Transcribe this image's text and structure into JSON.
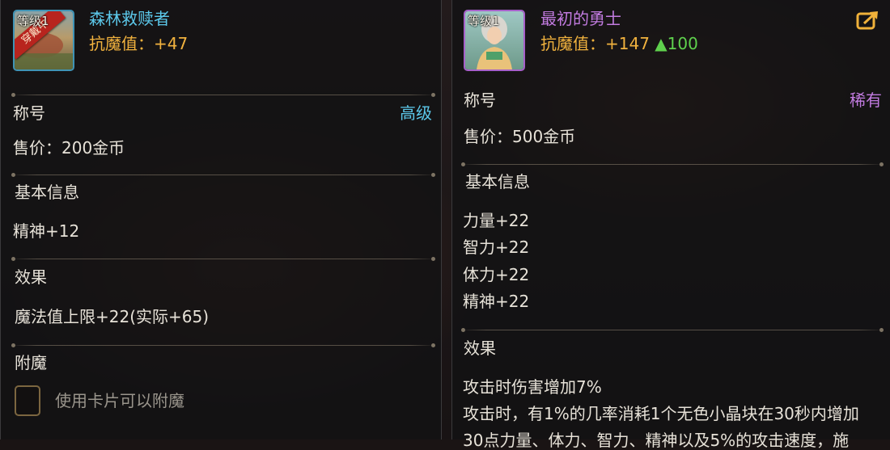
{
  "left_item": {
    "icon_level": "等级1",
    "equipped_badge": "穿戴中",
    "name": "森林救赎者",
    "anti_magic_label": "抗魔值：",
    "anti_magic_value": "+47",
    "type_label": "称号",
    "grade": "高级",
    "price": "售价：200金币",
    "basic_info_header": "基本信息",
    "stats": [
      "精神+12"
    ],
    "effect_header": "效果",
    "effects": [
      "魔法值上限+22(实际+65)"
    ],
    "enchant_header": "附魔",
    "enchant_hint": "使用卡片可以附魔"
  },
  "right_item": {
    "icon_level": "等级1",
    "name": "最初的勇士",
    "anti_magic_label": "抗魔值：",
    "anti_magic_value": "+147",
    "anti_magic_diff": "▲100",
    "type_label": "称号",
    "grade": "稀有",
    "price": "售价：500金币",
    "basic_info_header": "基本信息",
    "stats": [
      "力量+22",
      "智力+22",
      "体力+22",
      "精神+22"
    ],
    "effect_header": "效果",
    "effects": [
      "攻击时伤害增加7%",
      "攻击时，有1%的几率消耗1个无色小晶块在30秒内增加",
      "30点力量、体力、智力、精神以及5%的攻击速度，施"
    ]
  },
  "colors": {
    "title_left": "#5cc8ea",
    "title_right": "#c27be0",
    "anti_magic": "#f1b23e",
    "increase": "#5fd14d",
    "share_icon": "#f0b13a"
  },
  "icons": {
    "share": "share-export-icon",
    "left_item": "forest-item-icon",
    "right_item": "warrior-portrait-icon"
  }
}
